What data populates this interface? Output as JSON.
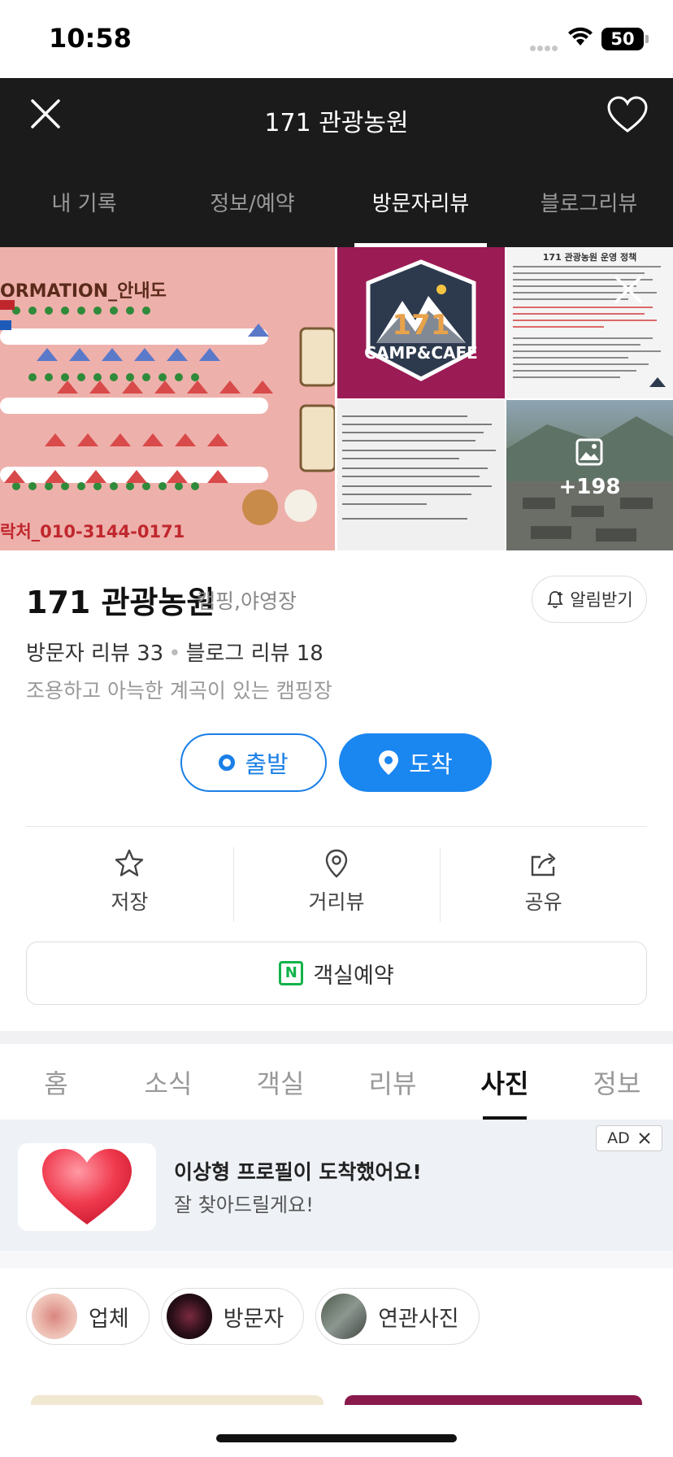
{
  "status_bar": {
    "time": "10:58",
    "battery": "50"
  },
  "header": {
    "title": "171 관광농원",
    "tabs": [
      {
        "label": "내 기록"
      },
      {
        "label": "정보/예약"
      },
      {
        "label": "방문자리뷰"
      },
      {
        "label": "블로그리뷰"
      }
    ],
    "active_tab": "방문자리뷰"
  },
  "photos": {
    "map_heading": "ORMATION_안내도",
    "map_phone": "락처_010-3144-0171",
    "logo_number": "171",
    "logo_text": "CAMP&CAFE",
    "policy_title": "171 관광농원 운영 정책",
    "more_count": "+198"
  },
  "place": {
    "name": "171 관광농원",
    "category": "캠핑,야영장",
    "alarm_label": "알림받기",
    "visitor_review_label": "방문자 리뷰 33",
    "blog_review_label": "블로그 리뷰 18",
    "description": "조용하고 아늑한 계곡이 있는 캠핑장"
  },
  "route": {
    "depart_label": "출발",
    "arrive_label": "도착"
  },
  "actions": [
    {
      "label": "저장",
      "icon": "star-icon"
    },
    {
      "label": "거리뷰",
      "icon": "map-pin-icon"
    },
    {
      "label": "공유",
      "icon": "share-icon"
    }
  ],
  "booking": {
    "label": "객실예약",
    "icon_letter": "N"
  },
  "sub_tabs": [
    {
      "label": "홈"
    },
    {
      "label": "소식"
    },
    {
      "label": "객실"
    },
    {
      "label": "리뷰"
    },
    {
      "label": "사진"
    },
    {
      "label": "정보"
    }
  ],
  "active_sub_tab": "사진",
  "ad": {
    "badge": "AD",
    "title": "이상형 프로필이 도착했어요!",
    "subtitle": "잘 찾아드릴게요!"
  },
  "photo_filters": [
    {
      "label": "업체"
    },
    {
      "label": "방문자"
    },
    {
      "label": "연관사진"
    }
  ],
  "colors": {
    "accent_blue": "#1a86f0",
    "header_bg": "#1b1b1b",
    "naver_green": "#12b24a"
  }
}
